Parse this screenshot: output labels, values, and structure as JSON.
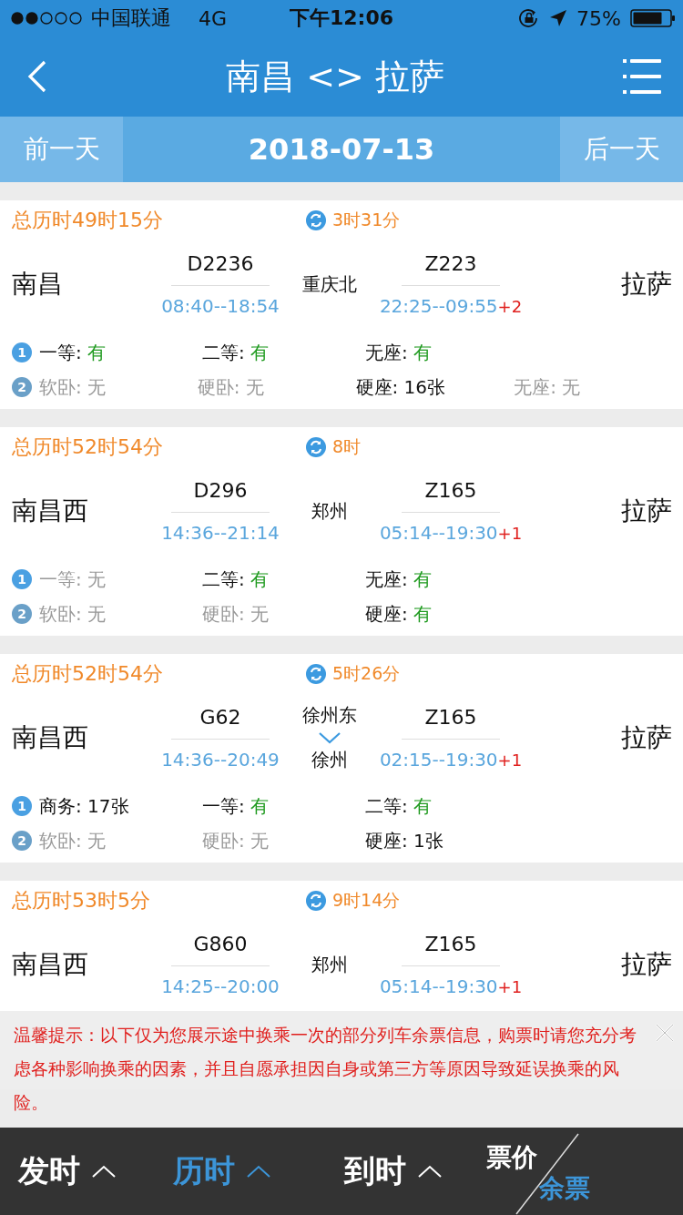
{
  "status_bar": {
    "carrier": "中国联通",
    "network": "4G",
    "time": "下午12:06",
    "battery": "75%"
  },
  "header": {
    "title": "南昌 <> 拉萨"
  },
  "date_bar": {
    "prev": "前一天",
    "date": "2018-07-13",
    "next": "后一天"
  },
  "routes": [
    {
      "total": "总历时49时15分",
      "wait": "3时31分",
      "from": "南昌",
      "to": "拉萨",
      "legs": [
        {
          "train": "D2236",
          "times": "08:40--18:54"
        },
        {
          "train": "Z223",
          "times": "22:25--09:55",
          "days": "+2"
        }
      ],
      "transfer": [
        "重庆北"
      ],
      "seat_rows": [
        {
          "badge": "1",
          "items": [
            {
              "label": "一等:",
              "value": "有",
              "kind": "available"
            },
            {
              "label": "二等:",
              "value": "有",
              "kind": "available"
            },
            {
              "label": "无座:",
              "value": "有",
              "kind": "available"
            }
          ]
        },
        {
          "badge": "2",
          "items": [
            {
              "label": "软卧:",
              "value": "无",
              "kind": "none"
            },
            {
              "label": "硬卧:",
              "value": "无",
              "kind": "none"
            },
            {
              "label": "硬座:",
              "value": "16张",
              "kind": "count"
            },
            {
              "label": "无座:",
              "value": "无",
              "kind": "none"
            }
          ]
        }
      ]
    },
    {
      "total": "总历时52时54分",
      "wait": "8时",
      "from": "南昌西",
      "to": "拉萨",
      "legs": [
        {
          "train": "D296",
          "times": "14:36--21:14"
        },
        {
          "train": "Z165",
          "times": "05:14--19:30",
          "days": "+1"
        }
      ],
      "transfer": [
        "郑州"
      ],
      "seat_rows": [
        {
          "badge": "1",
          "items": [
            {
              "label": "一等:",
              "value": "无",
              "kind": "none"
            },
            {
              "label": "二等:",
              "value": "有",
              "kind": "available"
            },
            {
              "label": "无座:",
              "value": "有",
              "kind": "available"
            }
          ]
        },
        {
          "badge": "2",
          "items": [
            {
              "label": "软卧:",
              "value": "无",
              "kind": "none"
            },
            {
              "label": "硬卧:",
              "value": "无",
              "kind": "none"
            },
            {
              "label": "硬座:",
              "value": "有",
              "kind": "available"
            }
          ]
        }
      ]
    },
    {
      "total": "总历时52时54分",
      "wait": "5时26分",
      "from": "南昌西",
      "to": "拉萨",
      "legs": [
        {
          "train": "G62",
          "times": "14:36--20:49"
        },
        {
          "train": "Z165",
          "times": "02:15--19:30",
          "days": "+1"
        }
      ],
      "transfer": [
        "徐州东",
        "徐州"
      ],
      "seat_rows": [
        {
          "badge": "1",
          "items": [
            {
              "label": "商务:",
              "value": "17张",
              "kind": "count"
            },
            {
              "label": "一等:",
              "value": "有",
              "kind": "available"
            },
            {
              "label": "二等:",
              "value": "有",
              "kind": "available"
            }
          ]
        },
        {
          "badge": "2",
          "items": [
            {
              "label": "软卧:",
              "value": "无",
              "kind": "none"
            },
            {
              "label": "硬卧:",
              "value": "无",
              "kind": "none"
            },
            {
              "label": "硬座:",
              "value": "1张",
              "kind": "count"
            }
          ]
        }
      ]
    },
    {
      "total": "总历时53时5分",
      "wait": "9时14分",
      "from": "南昌西",
      "to": "拉萨",
      "legs": [
        {
          "train": "G860",
          "times": "14:25--20:00"
        },
        {
          "train": "Z165",
          "times": "05:14--19:30",
          "days": "+1"
        }
      ],
      "transfer": [
        "郑州"
      ]
    }
  ],
  "notice": {
    "text": "温馨提示：以下仅为您展示途中换乘一次的部分列车余票信息，购票时请您充分考虑各种影响换乘的因素，并且自愿承担因自身或第三方等原因导致延误换乘的风险。"
  },
  "sort_bar": {
    "options": [
      {
        "label": "发时",
        "selected": false
      },
      {
        "label": "历时",
        "selected": true
      },
      {
        "label": "到时",
        "selected": false
      }
    ],
    "toggle": [
      {
        "label": "票价",
        "selected": false
      },
      {
        "label": "余票",
        "selected": true
      }
    ]
  }
}
